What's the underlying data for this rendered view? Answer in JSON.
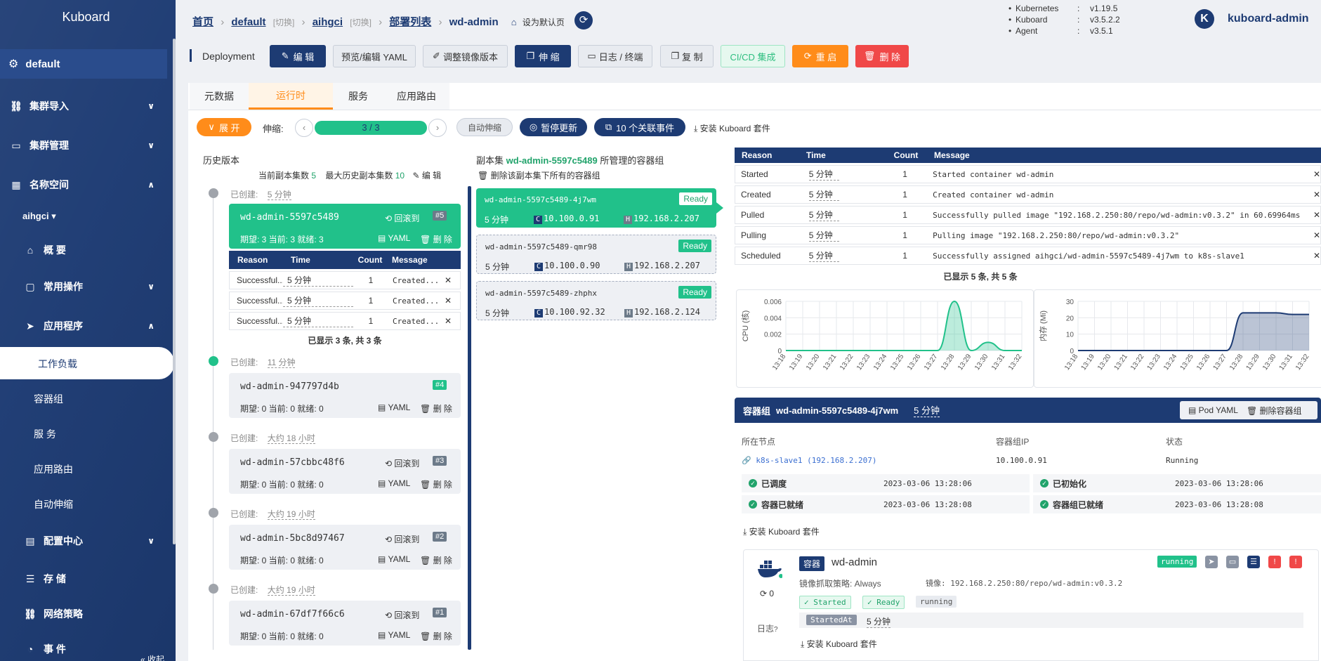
{
  "sidebar": {
    "logo": "Kuboard",
    "cluster": "default",
    "items": [
      {
        "label": "集群导入"
      },
      {
        "label": "集群管理"
      },
      {
        "label": "名称空间"
      },
      {
        "label": "aihgci"
      },
      {
        "label": "概 要"
      },
      {
        "label": "常用操作"
      },
      {
        "label": "应用程序"
      },
      {
        "label": "工作负载"
      },
      {
        "label": "容器组"
      },
      {
        "label": "服 务"
      },
      {
        "label": "应用路由"
      },
      {
        "label": "自动伸缩"
      },
      {
        "label": "配置中心"
      },
      {
        "label": "存 储"
      },
      {
        "label": "网络策略"
      },
      {
        "label": "事 件"
      }
    ],
    "collapse": "收起"
  },
  "breadcrumb": {
    "home": "首页",
    "cluster": "default",
    "switch": "[切换]",
    "namespace": "aihgci",
    "list": "部署列表",
    "current": "wd-admin",
    "set_default": "设为默认页"
  },
  "versions": {
    "rows": [
      {
        "k": "Kubernetes",
        "v": "v1.19.5"
      },
      {
        "k": "Kuboard",
        "v": "v3.5.2.2"
      },
      {
        "k": "Agent",
        "v": "v3.5.1"
      }
    ],
    "user_initial": "K",
    "user": "kuboard-admin"
  },
  "toolbar": {
    "kind": "Deployment",
    "edit": "编 辑",
    "yaml": "预览/编辑 YAML",
    "image": "调整镜像版本",
    "scale": "伸 缩",
    "logs": "日志 / 终端",
    "copy": "复 制",
    "cicd": "CI/CD 集成",
    "restart": "重 启",
    "delete": "删 除"
  },
  "tabs": [
    "元数据",
    "运行时",
    "服务",
    "应用路由"
  ],
  "controls": {
    "expand": "展 开",
    "scale_label": "伸缩:",
    "replicas": "3 / 3",
    "replica_fraction": 1.0,
    "autoscale": "自动伸缩",
    "pause": "暂停更新",
    "events": "10 个关联事件",
    "install": "安装 Kuboard 套件"
  },
  "history": {
    "title": "历史版本",
    "current_label": "当前副本集数",
    "current_val": "5",
    "max_label": "最大历史副本集数",
    "max_val": "10",
    "edit": "编 辑",
    "created": "已创建:",
    "rollback": "回滚到",
    "yaml": "YAML",
    "del": "删 除",
    "items": [
      {
        "age": "5 分钟",
        "name": "wd-admin-5597c5489",
        "rev": "#5",
        "stats": "期望: 3 当前: 3 就绪: 3"
      },
      {
        "age": "11 分钟",
        "name": "wd-admin-947797d4b",
        "rev": "#4",
        "stats": "期望: 0 当前: 0 就绪: 0"
      },
      {
        "age": "大约 18 小时",
        "name": "wd-admin-57cbbc48f6",
        "rev": "#3",
        "stats": "期望: 0 当前: 0 就绪: 0"
      },
      {
        "age": "大约 19 小时",
        "name": "wd-admin-5bc8d97467",
        "rev": "#2",
        "stats": "期望: 0 当前: 0 就绪: 0"
      },
      {
        "age": "大约 19 小时",
        "name": "wd-admin-67df7f66c6",
        "rev": "#1",
        "stats": "期望: 0 当前: 0 就绪: 0"
      }
    ],
    "events_header": [
      "Reason",
      "Time",
      "Count",
      "Message"
    ],
    "events": [
      {
        "reason": "Successful...",
        "time": "5 分钟",
        "count": "1",
        "msg": "Created..."
      },
      {
        "reason": "Successful...",
        "time": "5 分钟",
        "count": "1",
        "msg": "Created..."
      },
      {
        "reason": "Successful...",
        "time": "5 分钟",
        "count": "1",
        "msg": "Created..."
      }
    ],
    "events_footer": "已显示 3 条, 共 3 条"
  },
  "replicaset": {
    "title_pre": "副本集",
    "title_name": "wd-admin-5597c5489",
    "title_post": "所管理的容器组",
    "delete_all": "删除该副本集下所有的容器组",
    "pods": [
      {
        "name": "wd-admin-5597c5489-4j7wm",
        "age": "5 分钟",
        "ip": "10.100.0.91",
        "host": "192.168.2.207",
        "status": "Ready"
      },
      {
        "name": "wd-admin-5597c5489-qmr98",
        "age": "5 分钟",
        "ip": "10.100.0.90",
        "host": "192.168.2.207",
        "status": "Ready"
      },
      {
        "name": "wd-admin-5597c5489-zhphx",
        "age": "5 分钟",
        "ip": "10.100.92.32",
        "host": "192.168.2.124",
        "status": "Ready"
      }
    ]
  },
  "events": {
    "header": [
      "Reason",
      "Time",
      "Count",
      "Message"
    ],
    "rows": [
      {
        "reason": "Started",
        "time": "5 分钟",
        "count": "1",
        "msg": "Started container wd-admin"
      },
      {
        "reason": "Created",
        "time": "5 分钟",
        "count": "1",
        "msg": "Created container wd-admin"
      },
      {
        "reason": "Pulled",
        "time": "5 分钟",
        "count": "1",
        "msg": "Successfully pulled image \"192.168.2.250:80/repo/wd-admin:v0.3.2\" in 60.69964ms"
      },
      {
        "reason": "Pulling",
        "time": "5 分钟",
        "count": "1",
        "msg": "Pulling image \"192.168.2.250:80/repo/wd-admin:v0.3.2\""
      },
      {
        "reason": "Scheduled",
        "time": "5 分钟",
        "count": "1",
        "msg": "Successfully assigned aihgci/wd-admin-5597c5489-4j7wm to k8s-slave1"
      }
    ],
    "footer": "已显示 5 条, 共 5 条"
  },
  "chart_data": [
    {
      "type": "area",
      "ylabel": "CPU (核)",
      "categories": [
        "13:18",
        "13:19",
        "13:20",
        "13:21",
        "13:22",
        "13:23",
        "13:24",
        "13:25",
        "13:26",
        "13:27",
        "13:28",
        "13:29",
        "13:30",
        "13:31",
        "13:32"
      ],
      "series": [
        {
          "values": [
            0,
            0,
            0,
            0,
            0,
            0,
            0,
            0,
            0,
            0,
            0.006,
            0,
            0.001,
            0,
            0
          ]
        }
      ],
      "yticks": [
        "0",
        "0.002",
        "0.004",
        "0.006"
      ],
      "ylim": [
        0,
        0.006
      ],
      "color": "#21c18a"
    },
    {
      "type": "area",
      "ylabel": "内存 (Mi)",
      "categories": [
        "13:18",
        "13:19",
        "13:20",
        "13:21",
        "13:22",
        "13:23",
        "13:24",
        "13:25",
        "13:26",
        "13:27",
        "13:28",
        "13:29",
        "13:30",
        "13:31",
        "13:32"
      ],
      "series": [
        {
          "values": [
            0,
            0,
            0,
            0,
            0,
            0,
            0,
            0,
            0,
            0,
            23,
            23,
            23,
            22,
            22
          ]
        }
      ],
      "yticks": [
        "0",
        "10",
        "20",
        "30"
      ],
      "ylim": [
        0,
        30
      ],
      "color": "#1d3b73"
    }
  ],
  "pod": {
    "title_label": "容器组",
    "name": "wd-admin-5597c5489-4j7wm",
    "age": "5 分钟",
    "pod_yaml": "Pod YAML",
    "delete_pod": "删除容器组",
    "node_label": "所在节点",
    "node_val": "k8s-slave1 (192.168.2.207)",
    "ip_label": "容器组IP",
    "ip_val": "10.100.0.91",
    "status_label": "状态",
    "status_val": "Running",
    "conditions": [
      {
        "label": "已调度",
        "time": "2023-03-06 13:28:06"
      },
      {
        "label": "已初始化",
        "time": "2023-03-06 13:28:06"
      },
      {
        "label": "容器已就绪",
        "time": "2023-03-06 13:28:08"
      },
      {
        "label": "容器组已就绪",
        "time": "2023-03-06 13:28:08"
      }
    ],
    "install": "安装 Kuboard 套件"
  },
  "container": {
    "tag": "容器",
    "name": "wd-admin",
    "state": "running",
    "pull_policy": "镜像抓取策略: Always",
    "image": "镜像: 192.168.2.250:80/repo/wd-admin:v0.3.2",
    "restarts": "0",
    "badges": [
      "Started",
      "Ready",
      "running"
    ],
    "started_label": "StartedAt",
    "started_val": "5 分钟",
    "log_label": "日志",
    "install": "安装 Kuboard 套件",
    "colors": {
      "green": "#21c18a",
      "gray": "#8a93a3",
      "red": "#f04848",
      "navy": "#1d3b73"
    }
  }
}
